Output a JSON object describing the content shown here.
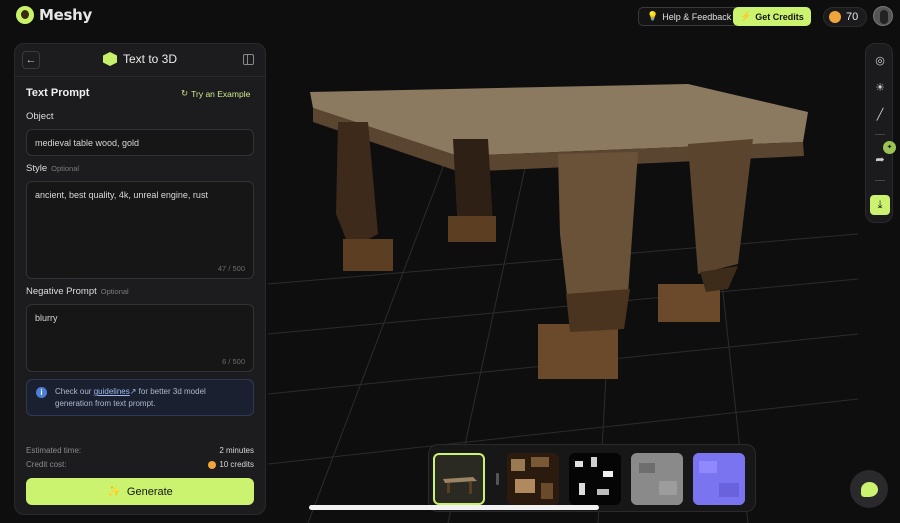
{
  "app": {
    "name": "Meshy"
  },
  "header": {
    "help_label": "Help & Feedback",
    "credits_label": "Get Credits",
    "balance": "70"
  },
  "panel": {
    "title": "Text to 3D",
    "section_title": "Text Prompt",
    "try_example": "Try an Example",
    "object_label": "Object",
    "object_value": "medieval table wood, gold",
    "style_label": "Style",
    "style_optional": "Optional",
    "style_value": "ancient, best quality, 4k,  unreal engine, rust",
    "style_counter": "47 / 500",
    "negative_label": "Negative Prompt",
    "negative_optional": "Optional",
    "negative_value": "blurry",
    "negative_counter": "6 / 500",
    "info_pre": "Check our ",
    "info_link": "guidelines",
    "info_post": " for better 3d model generation from text prompt.",
    "est_time_label": "Estimated time:",
    "est_time_value": "2 minutes",
    "cost_label": "Credit cost:",
    "cost_value": "10 credits",
    "generate_label": "Generate"
  },
  "colors": {
    "accent": "#cbf36f",
    "panel_bg": "#1c1c1e",
    "page_bg": "#0e0e0f"
  },
  "toolbar": {
    "icons": [
      "camera-icon",
      "light-icon",
      "texture-icon",
      "share-icon",
      "download-icon"
    ]
  },
  "thumbnails": {
    "items": [
      "model-preview",
      "base-color-map",
      "metallic-map",
      "roughness-map",
      "normal-map"
    ],
    "selected": 0
  }
}
